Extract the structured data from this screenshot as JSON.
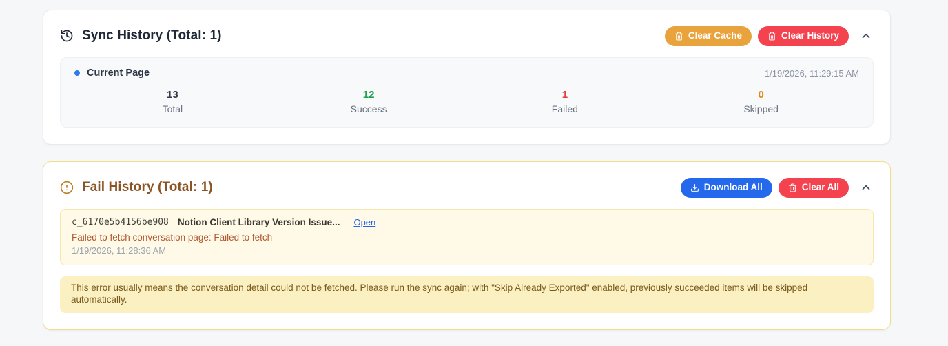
{
  "sync_card": {
    "title": "Sync History (Total: 1)",
    "clear_cache_label": "Clear Cache",
    "clear_history_label": "Clear History",
    "panel": {
      "scope_label": "Current Page",
      "timestamp": "1/19/2026, 11:29:15 AM",
      "stats": [
        {
          "value": "13",
          "label": "Total",
          "color": "#323c4b"
        },
        {
          "value": "12",
          "label": "Success",
          "color": "#1ea14d"
        },
        {
          "value": "1",
          "label": "Failed",
          "color": "#e23b42"
        },
        {
          "value": "0",
          "label": "Skipped",
          "color": "#dd8a1d"
        }
      ]
    }
  },
  "fail_card": {
    "title": "Fail History (Total: 1)",
    "download_all_label": "Download All",
    "clear_all_label": "Clear All",
    "item": {
      "id": "c_6170e5b4156be908",
      "title": "Notion Client Library Version Issue...",
      "open_label": "Open",
      "error": "Failed to fetch conversation page: Failed to fetch",
      "timestamp": "1/19/2026, 11:28:36 AM"
    },
    "note": "This error usually means the conversation detail could not be fetched. Please run the sync again; with \"Skip Already Exported\" enabled, previously succeeded items will be skipped automatically."
  },
  "colors": {
    "page_background": "#f6f7f8",
    "warning_button": "#e8a33d",
    "danger_button": "#f4434f",
    "primary_button": "#2468eb",
    "fail_title_brown": "#8a5526",
    "link_blue": "#2563eb",
    "error_text": "#b2572e",
    "note_background": "#faf0c2",
    "current_page_dot": "#2f7be8"
  },
  "icons": {
    "history": "history-clock-arrow",
    "trash": "trash-can",
    "download": "download-arrow-tray",
    "alert": "alert-circle-exclamation",
    "chevron_up": "chevron-up",
    "dot": "bullet-dot"
  }
}
